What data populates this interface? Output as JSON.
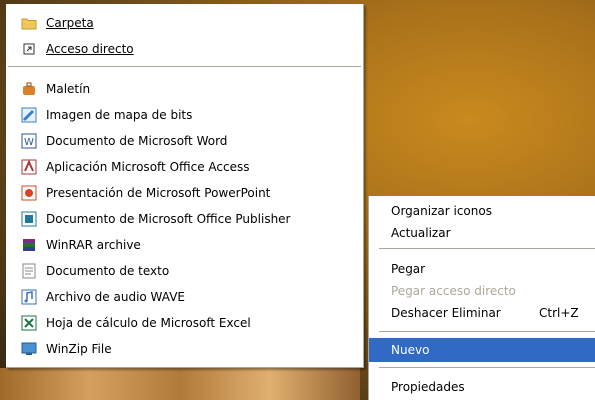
{
  "new_submenu": {
    "top_items": [
      {
        "label": "Carpeta",
        "icon": "folder-icon",
        "color": "#f2c65a"
      },
      {
        "label": "Acceso directo",
        "icon": "shortcut-icon",
        "color": "#333333"
      }
    ],
    "file_types": [
      {
        "label": "Maletín",
        "icon": "briefcase-icon",
        "color": "#d9822b"
      },
      {
        "label": "Imagen de mapa de bits",
        "icon": "paint-icon",
        "color": "#3a7bd5"
      },
      {
        "label": "Documento de Microsoft Word",
        "icon": "word-icon",
        "color": "#2b5797"
      },
      {
        "label": "Aplicación Microsoft Office Access",
        "icon": "access-icon",
        "color": "#a4373a"
      },
      {
        "label": "Presentación de Microsoft PowerPoint",
        "icon": "powerpoint-icon",
        "color": "#d24726"
      },
      {
        "label": "Documento de Microsoft Office Publisher",
        "icon": "publisher-icon",
        "color": "#1e7a9c"
      },
      {
        "label": "WinRAR archive",
        "icon": "winrar-icon",
        "color": "#7a2c8c"
      },
      {
        "label": "Documento de texto",
        "icon": "text-document-icon",
        "color": "#888888"
      },
      {
        "label": "Archivo de audio WAVE",
        "icon": "audio-icon",
        "color": "#3a6fc4"
      },
      {
        "label": "Hoja de cálculo de Microsoft Excel",
        "icon": "excel-icon",
        "color": "#1f7244"
      },
      {
        "label": "WinZip File",
        "icon": "winzip-icon",
        "color": "#4a8fd0"
      }
    ]
  },
  "context_menu": {
    "organize_icons": "Organizar iconos",
    "refresh": "Actualizar",
    "paste": "Pegar",
    "paste_shortcut": "Pegar acceso directo",
    "undo_delete": "Deshacer Eliminar",
    "undo_shortcut": "Ctrl+Z",
    "new": "Nuevo",
    "properties": "Propiedades",
    "selection_color": "#316ac5",
    "disabled_color": "#aca899"
  }
}
